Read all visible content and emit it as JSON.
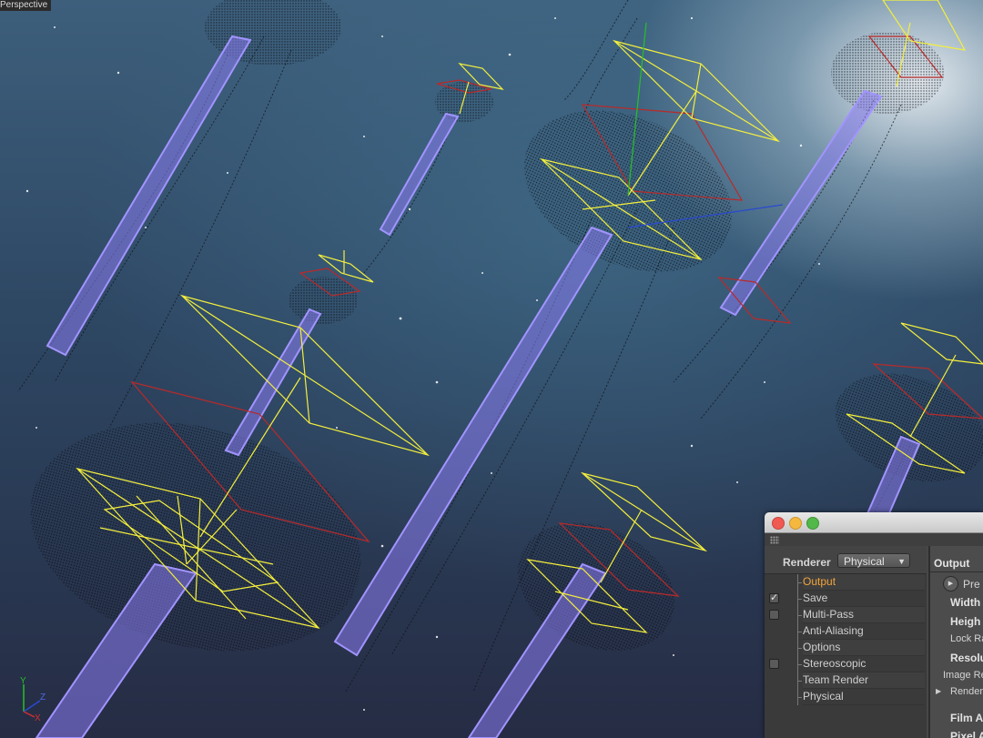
{
  "viewport": {
    "label": "Perspective",
    "axis": {
      "y": "Y",
      "z": "Z",
      "x": "X"
    },
    "colors": {
      "wireframe_yellow": "#f4ef3c",
      "wireframe_red": "#b82a2a",
      "tentacle_purple": "#a294ff",
      "y_axis": "#26c026",
      "z_axis": "#2a4ad0",
      "x_axis": "#d03030"
    }
  },
  "window": {
    "controls": [
      "close",
      "minimize",
      "zoom"
    ],
    "renderer": {
      "label": "Renderer",
      "selected": "Physical"
    },
    "settings": [
      {
        "label": "Output",
        "checkbox": false,
        "checked": false,
        "selected": true
      },
      {
        "label": "Save",
        "checkbox": true,
        "checked": true,
        "selected": false
      },
      {
        "label": "Multi-Pass",
        "checkbox": true,
        "checked": false,
        "selected": false
      },
      {
        "label": "Anti-Aliasing",
        "checkbox": false,
        "checked": false,
        "selected": false
      },
      {
        "label": "Options",
        "checkbox": false,
        "checked": false,
        "selected": false
      },
      {
        "label": "Stereoscopic",
        "checkbox": true,
        "checked": false,
        "selected": false
      },
      {
        "label": "Team Render",
        "checkbox": false,
        "checked": false,
        "selected": false
      },
      {
        "label": "Physical",
        "checkbox": false,
        "checked": false,
        "selected": false
      }
    ],
    "right": {
      "title": "Output",
      "preset_label": "Pre",
      "width_label": "Width",
      "height_label": "Heigh",
      "lock_ratio_label": "Lock Ra",
      "resolution_label": "Resolu",
      "image_res_label": "Image Re",
      "render_label": "Render",
      "film_label": "Film A",
      "pixel_label": "Pixel A"
    }
  }
}
